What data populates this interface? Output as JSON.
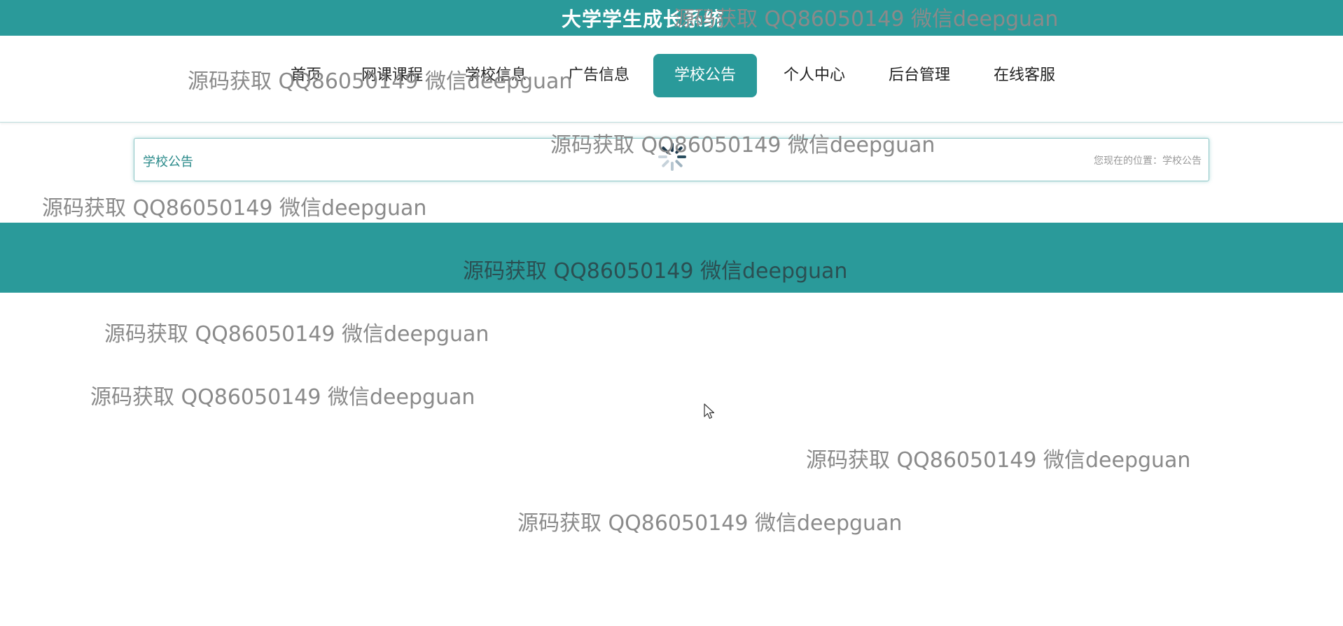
{
  "header": {
    "title": "大学学生成长系统"
  },
  "nav": {
    "items": [
      {
        "label": "首页"
      },
      {
        "label": "网课课程"
      },
      {
        "label": "学校信息"
      },
      {
        "label": "广告信息"
      },
      {
        "label": "学校公告"
      },
      {
        "label": "个人中心"
      },
      {
        "label": "后台管理"
      },
      {
        "label": "在线客服"
      }
    ],
    "active": "学校公告"
  },
  "breadcrumb": {
    "title": "学校公告",
    "location_label": "您现在的位置：",
    "location_value": "学校公告"
  },
  "watermarks": [
    "源码获取 QQ86050149 微信deepguan",
    "源码获取 QQ86050149 微信deepguan",
    "源码获取 QQ86050149 微信deepguan",
    "源码获取 QQ86050149 微信deepguan",
    "源码获取 QQ86050149 微信deepguan",
    "源码获取 QQ86050149 微信deepguan",
    "源码获取 QQ86050149 微信deepguan",
    "源码获取 QQ86050149 微信deepguan",
    "源码获取 QQ86050149 微信deepguan"
  ],
  "colors": {
    "accent": "#2a9a9a",
    "watermark": "#8a8a8a"
  },
  "icons": {
    "loading": "loading-spinner-icon",
    "cursor": "mouse-pointer-icon"
  }
}
